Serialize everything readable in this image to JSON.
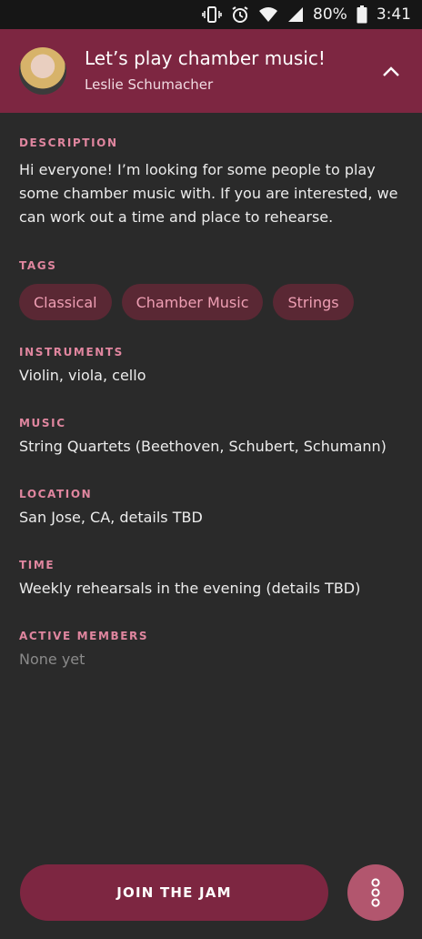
{
  "status_bar": {
    "battery_percent": "80%",
    "time": "3:41",
    "icons": [
      "vibrate-icon",
      "alarm-icon",
      "wifi-icon",
      "signal-icon",
      "battery-icon"
    ]
  },
  "header": {
    "title": "Let’s play chamber music!",
    "author": "Leslie Schumacher",
    "background_color": "#7d2641"
  },
  "sections": {
    "description": {
      "label": "DESCRIPTION",
      "text": "Hi everyone! I’m looking for some people to play some chamber music with. If you are interested, we can work out a time and place to rehearse."
    },
    "tags": {
      "label": "TAGS",
      "items": [
        "Classical",
        "Chamber Music",
        "Strings"
      ]
    },
    "instruments": {
      "label": "INSTRUMENTS",
      "text": "Violin, viola, cello"
    },
    "music": {
      "label": "MUSIC",
      "text": "String Quartets (Beethoven, Schubert, Schumann)"
    },
    "location": {
      "label": "LOCATION",
      "text": "San Jose, CA, details TBD"
    },
    "time": {
      "label": "TIME",
      "text": "Weekly rehearsals in the evening (details TBD)"
    },
    "active_members": {
      "label": "ACTIVE MEMBERS",
      "text": "None yet"
    }
  },
  "actions": {
    "join_label": "JOIN THE JAM",
    "accent_color": "#7d2641",
    "more_color": "#b2566e"
  }
}
